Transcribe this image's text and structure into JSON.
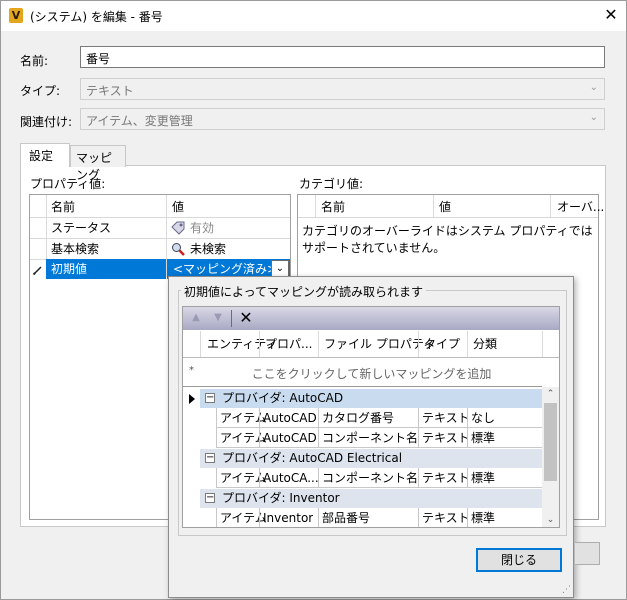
{
  "window": {
    "app_icon": "V",
    "title": "(システム) を編集 - 番号",
    "close_glyph": "✕"
  },
  "form": {
    "name_label": "名前:",
    "name_value": "番号",
    "type_label": "タイプ:",
    "type_value": "テキスト",
    "related_label": "関連付け:",
    "related_value": "アイテム、変更管理"
  },
  "tabs": [
    {
      "label": "設定"
    },
    {
      "label": "マッピング"
    }
  ],
  "properties": {
    "section_label": "プロパティ値:",
    "headers": {
      "name": "名前",
      "value": "値"
    },
    "rows": [
      {
        "name": "ステータス",
        "value": "有効",
        "icon": "tag-icon"
      },
      {
        "name": "基本検索",
        "value": "未検索",
        "icon": "search-icon"
      },
      {
        "name": "初期値",
        "value": "<マッピング済み>",
        "icon": "pencil-icon",
        "selected": true
      }
    ]
  },
  "categories": {
    "section_label": "カテゴリ値:",
    "headers": {
      "name": "名前",
      "value": "値",
      "override": "オーバ..."
    },
    "message": "カテゴリのオーバーライドはシステム プロパティではサポートされていません。"
  },
  "mapping_popup": {
    "group_title": "初期値によってマッピングが読み取られます",
    "toolbar": {
      "up": "▲",
      "down": "▼",
      "delete": "✕"
    },
    "headers": [
      "エンティティ",
      "プロパ...",
      "ファイル プロパティ",
      "タイプ",
      "分類"
    ],
    "new_row_marker": "*",
    "new_row_hint": "ここをクリックして新しいマッピングを追加",
    "providers": [
      {
        "label": "プロバイダ: AutoCAD",
        "rows": [
          [
            "アイテム",
            "AutoCAD",
            "カタログ番号",
            "テキスト",
            "なし"
          ],
          [
            "アイテム",
            "AutoCAD",
            "コンポーネント名",
            "テキスト",
            "標準"
          ]
        ]
      },
      {
        "label": "プロバイダ: AutoCAD Electrical",
        "rows": [
          [
            "アイテム",
            "AutoCA...",
            "コンポーネント名",
            "テキスト",
            "標準"
          ]
        ]
      },
      {
        "label": "プロバイダ: Inventor",
        "rows": [
          [
            "アイテム",
            "Inventor",
            "部品番号",
            "テキスト",
            "標準"
          ]
        ]
      }
    ],
    "close_button": "閉じる"
  }
}
